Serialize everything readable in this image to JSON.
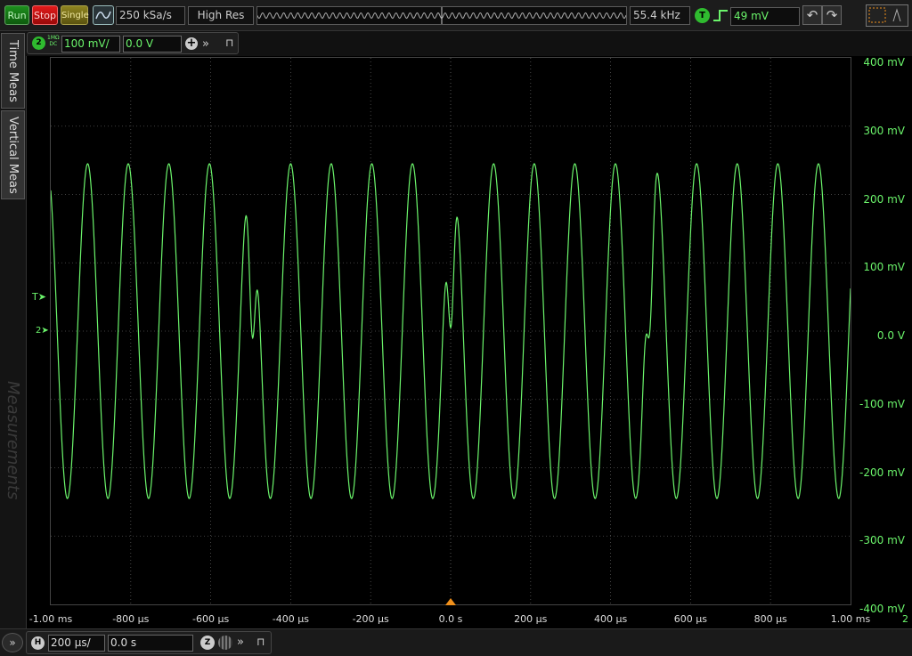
{
  "toolbar": {
    "run": "Run",
    "stop": "Stop",
    "single": "Single",
    "sample_rate": "250 kSa/s",
    "acq_mode": "High Res",
    "frequency": "55.4 kHz",
    "trigger_badge": "T",
    "trigger_level": "49 mV"
  },
  "sidebar": {
    "tabs": [
      "Time Meas",
      "Vertical Meas"
    ],
    "watermark": "Measurements"
  },
  "channel": {
    "number": "2",
    "coupling_line1": "1MΩ",
    "coupling_line2": "DC",
    "scale": "100 mV/",
    "offset": "0.0 V",
    "add": "+"
  },
  "display": {
    "trigger_marker": "T",
    "channel_marker": "2",
    "channel_edge_label": "2"
  },
  "horizontal": {
    "badge": "H",
    "scale": "200 µs/",
    "delay": "0.0 s",
    "zoom_badge": "Z"
  },
  "colors": {
    "trace": "#6bf46b",
    "grid": "#555555",
    "trigger_pos": "#f0901c"
  },
  "chart_data": {
    "type": "line",
    "x_unit": "s",
    "y_unit": "V",
    "xlim": [
      -0.001,
      0.001
    ],
    "ylim": [
      -0.4,
      0.4
    ],
    "ytick_labels": [
      "400 mV",
      "300 mV",
      "200 mV",
      "100 mV",
      "0.0 V",
      "-100 mV",
      "-200 mV",
      "-300 mV",
      "-400 mV"
    ],
    "xtick_labels": [
      "-1.00 ms",
      "-800 µs",
      "-600 µs",
      "-400 µs",
      "-200 µs",
      "0.0 s",
      "200 µs",
      "400 µs",
      "600 µs",
      "800 µs",
      "1.00 ms"
    ],
    "grid": true,
    "series": [
      {
        "frequency_hz": 9850,
        "amplitude_v": 0.245,
        "note_points": [
          {
            "x": -0.000495,
            "y": -0.01
          },
          {
            "x": 0.0,
            "y": 0.005
          },
          {
            "x": 0.000495,
            "y": -0.01
          }
        ]
      }
    ]
  }
}
